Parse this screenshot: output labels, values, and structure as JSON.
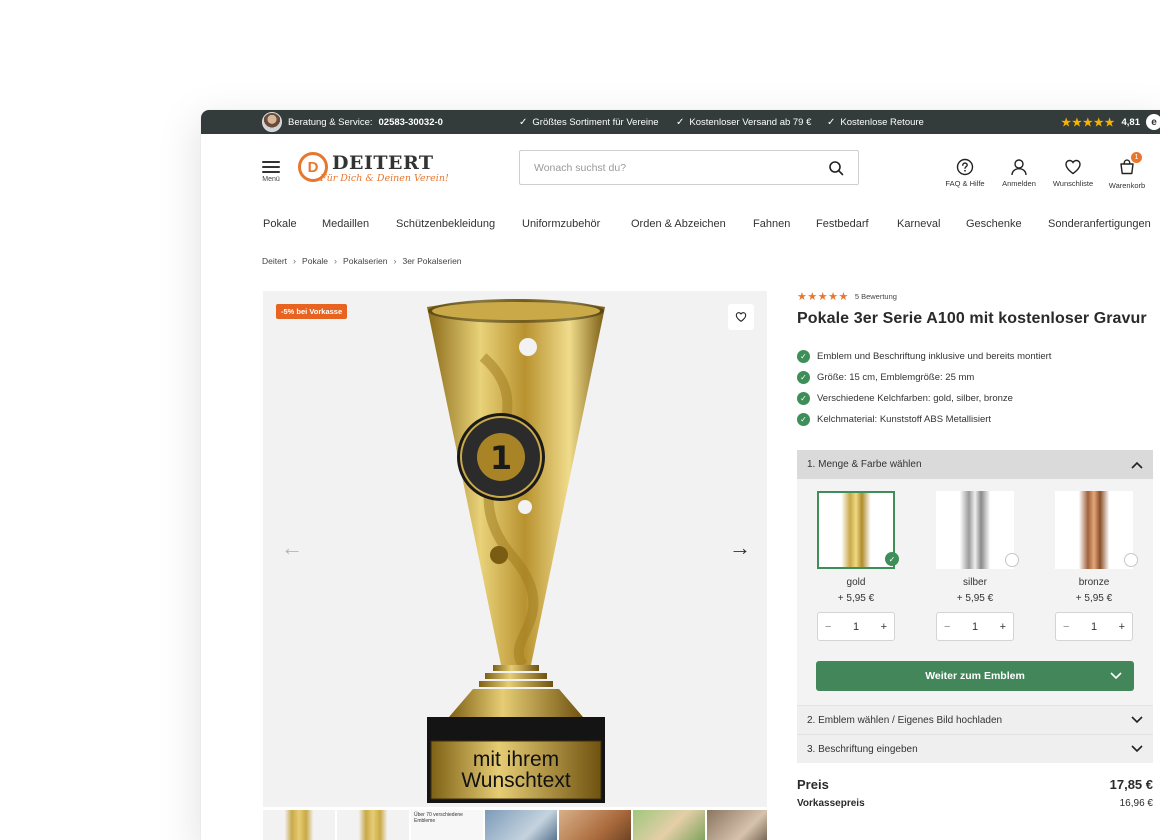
{
  "topbar": {
    "service_label": "Beratung & Service:",
    "phone": "02583-30032-0",
    "usps": [
      "Größtes Sortiment für Vereine",
      "Kostenloser Versand ab 79 €",
      "Kostenlose Retoure"
    ],
    "rating_stars": "★★★★★",
    "rating_value": "4,81",
    "colors": {
      "background": "#333b3b",
      "star": "#f5b301"
    }
  },
  "header": {
    "menu_label": "Menü",
    "logo_name": "DEITERT",
    "logo_slogan": "Für Dich & Deinen Verein!",
    "search_placeholder": "Wonach suchst du?",
    "icons": [
      {
        "name": "faq-icon",
        "label": "FAQ & Hilfe"
      },
      {
        "name": "user-icon",
        "label": "Anmelden"
      },
      {
        "name": "heart-icon",
        "label": "Wunschliste"
      },
      {
        "name": "cart-icon",
        "label": "Warenkorb",
        "badge": "1"
      }
    ]
  },
  "nav": {
    "items": [
      "Pokale",
      "Medaillen",
      "Schützenbekleidung",
      "Uniformzubehör",
      "Orden & Abzeichen",
      "Fahnen",
      "Festbedarf",
      "Karneval",
      "Geschenke",
      "Sonderanfertigungen"
    ]
  },
  "breadcrumb": [
    "Deitert",
    "Pokale",
    "Pokalserien",
    "3er Pokalserien"
  ],
  "gallery": {
    "sale_badge": "-5% bei Vorkasse",
    "plate_line1": "mit ihrem",
    "plate_line2": "Wunschtext",
    "thumb_caption": "Über 70 verschiedene Embleme"
  },
  "product": {
    "stars": "★★★★★",
    "review_count": "5 Bewertung",
    "title": "Pokale 3er Serie A100 mit kostenloser Gravur",
    "features": [
      "Emblem und Beschriftung inklusive und bereits montiert",
      "Größe: 15 cm, Emblemgröße: 25 mm",
      "Verschiedene Kelchfarben: gold, silber, bronze",
      "Kelchmaterial: Kunststoff ABS Metallisiert"
    ],
    "accent_green": "#43865a",
    "accent_orange": "#e8772e"
  },
  "config": {
    "step1_label": "1. Menge & Farbe wählen",
    "variants": [
      {
        "name": "gold",
        "price": "+ 5,95 €",
        "qty": "1",
        "selected": true
      },
      {
        "name": "silber",
        "price": "+ 5,95 €",
        "qty": "1",
        "selected": false
      },
      {
        "name": "bronze",
        "price": "+ 5,95 €",
        "qty": "1",
        "selected": false
      }
    ],
    "cta_label": "Weiter zum Emblem",
    "step2_label": "2. Emblem wählen / Eigenes Bild hochladen",
    "step3_label": "3. Beschriftung eingeben"
  },
  "pricing": {
    "price_label": "Preis",
    "price_value": "17,85 €",
    "prepay_label": "Vorkassepreis",
    "prepay_value": "16,96 €"
  }
}
